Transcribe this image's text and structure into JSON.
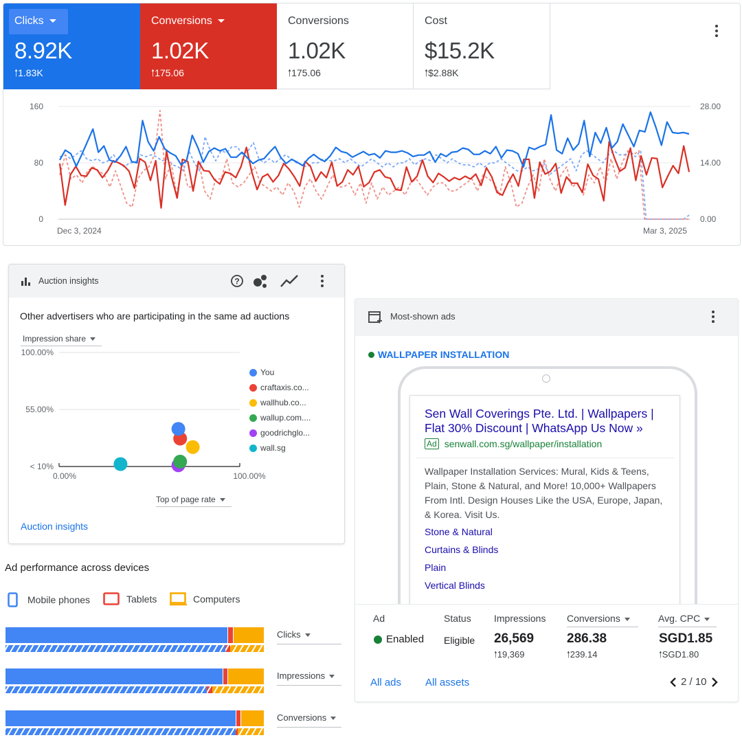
{
  "scorecards": [
    {
      "label": "Clicks",
      "value": "8.92K",
      "delta": "1.83K",
      "has_dropdown": true,
      "color": "#1a73e8"
    },
    {
      "label": "Conversions",
      "value": "1.02K",
      "delta": "175.06",
      "has_dropdown": true,
      "color": "#d93025"
    },
    {
      "label": "Conversions",
      "value": "1.02K",
      "delta": "175.06",
      "has_dropdown": false,
      "color": "#ffffff"
    },
    {
      "label": "Cost",
      "value": "$15.2K",
      "delta": "$2.88K",
      "has_dropdown": false,
      "color": "#ffffff"
    }
  ],
  "chart_data": {
    "type": "line",
    "x_start_label": "Dec 3, 2024",
    "x_end_label": "Mar 3, 2025",
    "y_left_ticks": [
      "0",
      "80",
      "160"
    ],
    "y_right_ticks": [
      "0.00",
      "14.00",
      "28.00"
    ],
    "ylim_left": [
      0,
      160
    ],
    "ylim_right": [
      0,
      28
    ],
    "series": [
      {
        "axis": "left",
        "color": "#1a73e8",
        "style": "solid",
        "values": [
          84,
          98,
          93,
          75,
          92,
          110,
          128,
          95,
          104,
          84,
          81,
          90,
          103,
          82,
          80,
          140,
          110,
          97,
          117,
          100,
          94,
          90,
          77,
          84,
          119,
          102,
          81,
          96,
          101,
          97,
          100,
          88,
          88,
          95,
          87,
          79,
          84,
          86,
          95,
          103,
          88,
          79,
          85,
          81,
          76,
          86,
          92,
          86,
          82,
          90,
          102,
          96,
          94,
          88,
          92,
          96,
          91,
          93,
          87,
          97,
          95,
          95,
          97,
          94,
          89,
          91,
          91,
          96,
          81,
          93,
          89,
          95,
          96,
          101,
          99,
          92,
          92,
          97,
          93,
          103,
          87,
          98,
          97,
          93,
          74,
          102,
          99,
          103,
          106,
          148,
          98,
          93,
          115,
          98,
          107,
          140,
          89,
          123,
          108,
          130,
          101,
          110,
          135,
          119,
          103,
          126,
          124,
          152,
          130,
          105,
          138,
          123,
          122,
          123,
          121
        ]
      },
      {
        "axis": "left",
        "color": "#d93025",
        "style": "solid",
        "values": [
          79,
          20,
          63,
          75,
          62,
          61,
          73,
          70,
          59,
          69,
          83,
          80,
          76,
          68,
          44,
          86,
          81,
          55,
          83,
          16,
          97,
          59,
          30,
          85,
          82,
          40,
          82,
          69,
          68,
          56,
          50,
          67,
          65,
          59,
          75,
          102,
          67,
          42,
          60,
          64,
          53,
          62,
          79,
          71,
          60,
          47,
          82,
          75,
          54,
          67,
          59,
          81,
          47,
          53,
          70,
          63,
          75,
          46,
          52,
          67,
          70,
          60,
          58,
          42,
          41,
          74,
          53,
          61,
          84,
          61,
          52,
          65,
          60,
          54,
          59,
          56,
          61,
          57,
          64,
          48,
          73,
          60,
          38,
          34,
          51,
          64,
          47,
          85,
          85,
          30,
          81,
          64,
          68,
          79,
          37,
          60,
          51,
          51,
          38,
          78,
          62,
          57,
          26,
          110,
          87,
          68,
          73,
          101,
          55,
          90,
          63,
          87,
          86,
          45,
          61,
          76,
          65,
          104,
          67
        ]
      },
      {
        "axis": "right",
        "color": "#7baaf7",
        "style": "dashed",
        "values": [
          15.5,
          16,
          15,
          16,
          17,
          15,
          14.5,
          15,
          14,
          14.5,
          16,
          14,
          13,
          14,
          14,
          16,
          15.5,
          16,
          15.5,
          14.5,
          15,
          13.5,
          13,
          12,
          17,
          14,
          12,
          20.5,
          17,
          14.5,
          17,
          16.5,
          18,
          18,
          16,
          17,
          19,
          15,
          14,
          15,
          14,
          15,
          16,
          15,
          14,
          13.5,
          13,
          14,
          14,
          15,
          14.5,
          14.5,
          15,
          14,
          15,
          14,
          13,
          14,
          15,
          14,
          13,
          14,
          13,
          14,
          14,
          15,
          13.5,
          14.5,
          15,
          14.5,
          16,
          15,
          14,
          15,
          14,
          13.5,
          13.5,
          13,
          14,
          13,
          14,
          14,
          15,
          14,
          13,
          12,
          12,
          13,
          12,
          12.5,
          14,
          11,
          12,
          13,
          14,
          15,
          12,
          16,
          17,
          16,
          15,
          14,
          16,
          17,
          16,
          16,
          17,
          15.5,
          17,
          0,
          0,
          0,
          0,
          0,
          0,
          0,
          0,
          1
        ]
      },
      {
        "axis": "right",
        "color": "#ee8f87",
        "style": "dashed",
        "values": [
          11,
          16,
          10,
          11,
          9,
          12,
          13,
          12,
          11,
          8,
          12,
          8,
          4,
          3,
          10,
          12,
          13,
          16,
          27,
          10,
          14,
          6,
          14,
          8,
          8,
          14,
          7,
          5,
          10,
          10,
          15,
          9,
          8,
          9,
          11,
          13,
          9,
          8,
          7,
          8,
          6,
          9,
          7,
          3,
          8,
          10,
          7,
          5,
          8,
          11,
          8,
          8,
          9,
          6,
          9,
          4,
          9,
          5,
          8,
          6,
          7,
          8,
          6,
          9,
          10,
          8,
          6,
          8,
          9,
          9,
          7,
          7,
          8,
          9,
          10,
          7,
          11,
          10,
          9,
          6,
          13,
          9,
          3,
          4,
          8,
          11,
          7,
          15,
          10,
          7,
          11,
          13,
          8,
          9,
          6,
          11,
          9,
          13,
          9,
          15,
          10,
          14,
          17,
          16,
          17,
          0,
          0,
          0,
          0,
          0,
          0,
          0,
          0,
          0
        ]
      }
    ]
  },
  "auction": {
    "title": "Auction insights",
    "subtitle": "Other advertisers who are participating in the same ad auctions",
    "y_selector": "Impression share",
    "x_selector": "Top of page rate",
    "y_ticks": [
      "100.00%",
      "55.00%",
      "< 10%"
    ],
    "x_ticks": [
      "0.00%",
      "100.00%"
    ],
    "footer_link": "Auction insights",
    "chart_data": {
      "type": "scatter",
      "xlabel": "Top of page rate",
      "ylabel": "Impression share",
      "series": [
        {
          "name": "You",
          "color": "#4285f4",
          "x": 0.66,
          "y": 0.37
        },
        {
          "name": "craftaxis.co...",
          "color": "#ea4335",
          "x": 0.67,
          "y": 0.29
        },
        {
          "name": "wallhub.co...",
          "color": "#fbbc04",
          "x": 0.74,
          "y": 0.22
        },
        {
          "name": "wallup.com....",
          "color": "#34a853",
          "x": 0.67,
          "y": 0.1
        },
        {
          "name": "goodrichglo...",
          "color": "#a142f4",
          "x": 0.66,
          "y": 0.07
        },
        {
          "name": "wall.sg",
          "color": "#12b5cb",
          "x": 0.34,
          "y": 0.08
        }
      ]
    }
  },
  "ads": {
    "title": "Most-shown ads",
    "ad_group_label": "WALLPAPER INSTALLATION",
    "status_color": "#188038",
    "headline": "Sen Wall Coverings Pte. Ltd. | Wallpapers | Flat 30% Discount | WhatsApp Us Now »",
    "badge": "Ad",
    "display_url": "senwall.com.sg/wallpaper/installation",
    "description": "Wallpaper Installation Services: Mural, Kids & Teens, Plain, Stone & Natural, and More! 10,000+ Wallpapers From Intl. Design Houses Like the USA, Europe, Japan, & Korea. Visit Us.",
    "sitelinks": [
      "Stone & Natural",
      "Curtains & Blinds",
      "Plain",
      "Vertical Blinds"
    ],
    "table": {
      "headers": {
        "ad": "Ad",
        "status": "Status",
        "impressions": "Impressions",
        "conversions": "Conversions",
        "avg_cpc": "Avg. CPC"
      },
      "ad_status": "Enabled",
      "status": "Eligible",
      "impressions": "26,569",
      "impressions_delta": "19,369",
      "conversions": "286.38",
      "conversions_delta": "239.14",
      "avg_cpc": "SGD1.85",
      "avg_cpc_delta": "SGD1.80"
    },
    "all_ads": "All ads",
    "all_assets": "All assets",
    "pagination": "2 / 10"
  },
  "devices": {
    "title": "Ad performance across devices",
    "legend": [
      "Mobile phones",
      "Tablets",
      "Computers"
    ],
    "colors": {
      "mobile": "#4285f4",
      "tablet": "#ea4335",
      "computer": "#f9ab00"
    },
    "rows": [
      {
        "metric": "Clicks",
        "current": [
          0.86,
          0.02,
          0.12
        ],
        "previous": [
          0.85,
          0.02,
          0.13
        ]
      },
      {
        "metric": "Impressions",
        "current": [
          0.84,
          0.02,
          0.14
        ],
        "previous": [
          0.78,
          0.02,
          0.2
        ]
      },
      {
        "metric": "Conversions",
        "current": [
          0.89,
          0.02,
          0.09
        ],
        "previous": [
          0.89,
          0.01,
          0.1
        ]
      }
    ]
  }
}
